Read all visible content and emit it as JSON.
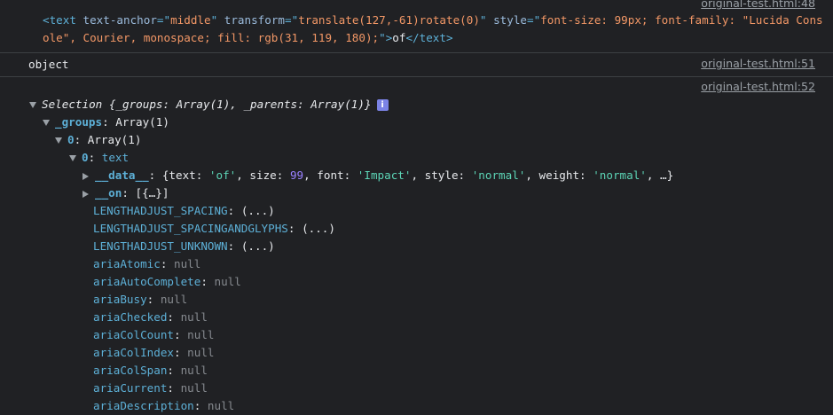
{
  "links": {
    "l48": "original-test.html:48",
    "l51": "original-test.html:51",
    "l52": "original-test.html:52"
  },
  "html_element": {
    "open": "<text",
    "a1_name": " text-anchor",
    "a1_eq": "=\"",
    "a1_val": "middle",
    "a1_close": "\"",
    "a2_name": " transform",
    "a2_eq": "=\"",
    "a2_val": "translate(127,-61)rotate(0)",
    "a2_close": "\"",
    "a3_name": " style",
    "a3_eq": "=\"",
    "a3_val": "font-size: 99px; font-family: \"Lucida Console\", Courier, monospace; fill: rgb(31, 119, 180);",
    "a3_close": "\">",
    "content": "of",
    "close": "</text>"
  },
  "object_line": "object",
  "tree": {
    "selection_label": "Selection",
    "selection_summary": " {_groups: Array(1), _parents: Array(1)}",
    "info_glyph": "i",
    "groups_key": "_groups",
    "groups_val": "Array(1)",
    "zero_key": "0",
    "zero_val": "Array(1)",
    "zero2_key": "0",
    "zero2_val": "text",
    "data_key": "__data__",
    "data_open": "{text: ",
    "data_text_val": "'of'",
    "data_size_key": ", size: ",
    "data_size_val": "99",
    "data_font_key": ", font: ",
    "data_font_val": "'Impact'",
    "data_style_key": ", style: ",
    "data_style_val": "'normal'",
    "data_weight_key": ", weight: ",
    "data_weight_val": "'normal'",
    "data_tail": ", …}",
    "on_key": "__on",
    "on_val": "[{…}]",
    "props": [
      {
        "k": "LENGTHADJUST_SPACING",
        "v": "(...)"
      },
      {
        "k": "LENGTHADJUST_SPACINGANDGLYPHS",
        "v": "(...)"
      },
      {
        "k": "LENGTHADJUST_UNKNOWN",
        "v": "(...)"
      },
      {
        "k": "ariaAtomic",
        "v": "null"
      },
      {
        "k": "ariaAutoComplete",
        "v": "null"
      },
      {
        "k": "ariaBusy",
        "v": "null"
      },
      {
        "k": "ariaChecked",
        "v": "null"
      },
      {
        "k": "ariaColCount",
        "v": "null"
      },
      {
        "k": "ariaColIndex",
        "v": "null"
      },
      {
        "k": "ariaColSpan",
        "v": "null"
      },
      {
        "k": "ariaCurrent",
        "v": "null"
      },
      {
        "k": "ariaDescription",
        "v": "null"
      }
    ]
  },
  "colors": {
    "background": "#202124",
    "tag": "#5db0d7",
    "string": "#5cd5b6",
    "number": "#9980ff",
    "null": "#868a8f"
  }
}
